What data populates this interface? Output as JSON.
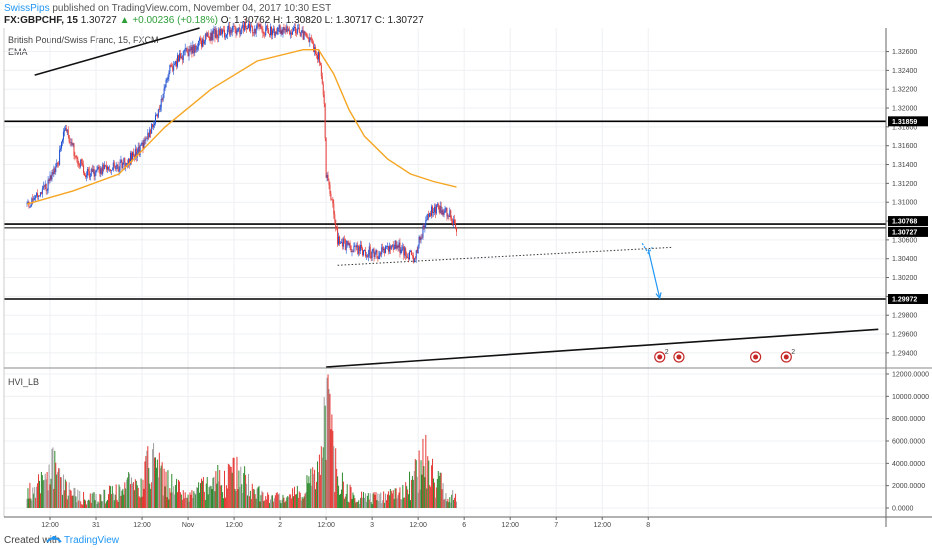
{
  "header": {
    "publisher": "SwissPips",
    "published_text": "published on TradingView.com, November 04, 2017 10:30 EST",
    "symbol": "FX:GBPCHF, 15",
    "last_price": "1.30727",
    "change": "+0.00236 (+0.18%)",
    "ohlc": "O: 1.30762  H: 1.30820  L: 1.30717  C: 1.30727"
  },
  "main_pane": {
    "instrument": "British Pound/Swiss Franc, 15, FXCM",
    "indicator": "EMA"
  },
  "volume_pane": {
    "indicator": "HVI_LB"
  },
  "footer": {
    "created_with": "Created with",
    "brand": "TradingView"
  },
  "colors": {
    "bull": "#2e8b2e",
    "bear": "#e53935",
    "neutral_vol": "#9e9e9e",
    "ema": "#f5a623",
    "level": "#000000",
    "projection": "#2196f3",
    "accent": "#2196f3"
  },
  "chart_data": [
    {
      "type": "candlestick",
      "title": "British Pound/Swiss Franc, 15, FXCM",
      "ylim": [
        1.2925,
        1.3285
      ],
      "x_ticks": [
        "12:00",
        "31",
        "12:00",
        "Nov",
        "12:00",
        "2",
        "12:00",
        "3",
        "12:00",
        "6",
        "12:00",
        "7",
        "12:00",
        "8"
      ],
      "y_ticks": [
        "1.32600",
        "1.32400",
        "1.32200",
        "1.32000",
        "1.31800",
        "1.31600",
        "1.31400",
        "1.31200",
        "1.31000",
        "1.30800",
        "1.30600",
        "1.30400",
        "1.30200",
        "1.30000",
        "1.29800",
        "1.29600",
        "1.29400"
      ],
      "price_tags": [
        "1.31859",
        "1.30768",
        "1.30727",
        "1.29972"
      ],
      "horizontal_levels": [
        1.31859,
        1.30768,
        1.30727,
        1.29972
      ],
      "trendlines": [
        {
          "from": [
            "Oct 30 08:00",
            1.3235
          ],
          "to": [
            "Nov 1 03:00",
            1.3285
          ]
        },
        {
          "from": [
            "Nov 2 12:00",
            1.2925
          ],
          "to": [
            "Nov 8 12:00",
            1.2965
          ]
        }
      ],
      "support_dotted": {
        "from": [
          "Nov 2 15:00",
          1.3033
        ],
        "to": [
          "Nov 6 06:00",
          1.3052
        ]
      },
      "projection_arrow": {
        "from": [
          "Nov 6 00:00",
          1.305
        ],
        "to": [
          "Nov 6 03:00",
          1.2998
        ]
      },
      "price_path": [
        [
          "Oct 30 06:00",
          1.3098
        ],
        [
          "Oct 30 09:00",
          1.3105
        ],
        [
          "Oct 30 11:00",
          1.3115
        ],
        [
          "Oct 30 14:00",
          1.314
        ],
        [
          "Oct 30 16:00",
          1.318
        ],
        [
          "Oct 30 19:00",
          1.3145
        ],
        [
          "Oct 30 22:00",
          1.3128
        ],
        [
          "Oct 31 02:00",
          1.3135
        ],
        [
          "Oct 31 07:00",
          1.314
        ],
        [
          "Oct 31 10:00",
          1.315
        ],
        [
          "Oct 31 13:00",
          1.3165
        ],
        [
          "Oct 31 16:00",
          1.3195
        ],
        [
          "Oct 31 19:00",
          1.324
        ],
        [
          "Oct 31 22:00",
          1.3255
        ],
        [
          "Nov 1 02:00",
          1.3265
        ],
        [
          "Nov 1 05:00",
          1.3275
        ],
        [
          "Nov 1 08:00",
          1.328
        ],
        [
          "Nov 1 11:00",
          1.3282
        ],
        [
          "Nov 1 15:00",
          1.3285
        ],
        [
          "Nov 1 19:00",
          1.3283
        ],
        [
          "Nov 2 00:00",
          1.3282
        ],
        [
          "Nov 2 05:00",
          1.328
        ],
        [
          "Nov 2 08:00",
          1.327
        ],
        [
          "Nov 2 10:00",
          1.3255
        ],
        [
          "Nov 2 11:30",
          1.321
        ],
        [
          "Nov 2 12:00",
          1.313
        ],
        [
          "Nov 2 13:00",
          1.311
        ],
        [
          "Nov 2 14:00",
          1.309
        ],
        [
          "Nov 2 15:00",
          1.306
        ],
        [
          "Nov 2 18:00",
          1.3052
        ],
        [
          "Nov 2 22:00",
          1.3048
        ],
        [
          "Nov 3 02:00",
          1.3045
        ],
        [
          "Nov 3 06:00",
          1.3055
        ],
        [
          "Nov 3 09:00",
          1.3045
        ],
        [
          "Nov 3 11:00",
          1.304
        ],
        [
          "Nov 3 13:00",
          1.3068
        ],
        [
          "Nov 3 15:00",
          1.3088
        ],
        [
          "Nov 3 17:00",
          1.3095
        ],
        [
          "Nov 3 19:00",
          1.309
        ],
        [
          "Nov 3 20:30",
          1.3085
        ],
        [
          "Nov 3 22:00",
          1.3073
        ]
      ],
      "ema_path": [
        [
          "Oct 30 06:00",
          1.3098
        ],
        [
          "Oct 30 18:00",
          1.3112
        ],
        [
          "Oct 31 06:00",
          1.313
        ],
        [
          "Oct 31 18:00",
          1.318
        ],
        [
          "Nov 1 06:00",
          1.322
        ],
        [
          "Nov 1 18:00",
          1.325
        ],
        [
          "Nov 2 06:00",
          1.3262
        ],
        [
          "Nov 2 10:00",
          1.3262
        ],
        [
          "Nov 2 14:00",
          1.3236
        ],
        [
          "Nov 2 18:00",
          1.3198
        ],
        [
          "Nov 2 22:00",
          1.317
        ],
        [
          "Nov 3 04:00",
          1.3146
        ],
        [
          "Nov 3 10:00",
          1.313
        ],
        [
          "Nov 3 16:00",
          1.3122
        ],
        [
          "Nov 3 22:00",
          1.3116
        ]
      ]
    },
    {
      "type": "bar",
      "title": "HVI_LB",
      "ylim": [
        0,
        12000
      ],
      "y_ticks": [
        "12000.0000",
        "10000.0000",
        "8000.0000",
        "6000.0000",
        "4000.0000",
        "2000.0000",
        "0.0000"
      ],
      "volume_profile": [
        [
          "Oct 30 06:00",
          1800
        ],
        [
          "Oct 30 10:00",
          3500
        ],
        [
          "Oct 30 13:00",
          4800
        ],
        [
          "Oct 30 16:00",
          2500
        ],
        [
          "Oct 30 20:00",
          1200
        ],
        [
          "Oct 31 02:00",
          1400
        ],
        [
          "Oct 31 08:00",
          2600
        ],
        [
          "Oct 31 12:00",
          3800
        ],
        [
          "Oct 31 15:00",
          5500
        ],
        [
          "Oct 31 19:00",
          2800
        ],
        [
          "Nov 1 01:00",
          1400
        ],
        [
          "Nov 1 06:00",
          3000
        ],
        [
          "Nov 1 10:00",
          3600
        ],
        [
          "Nov 1 13:00",
          4200
        ],
        [
          "Nov 1 16:00",
          2500
        ],
        [
          "Nov 1 20:00",
          1300
        ],
        [
          "Nov 2 02:00",
          1200
        ],
        [
          "Nov 2 07:00",
          2500
        ],
        [
          "Nov 2 10:00",
          4000
        ],
        [
          "Nov 2 12:00",
          11500
        ],
        [
          "Nov 2 13:30",
          8000
        ],
        [
          "Nov 2 15:00",
          3200
        ],
        [
          "Nov 2 19:00",
          1500
        ],
        [
          "Nov 3 01:00",
          1200
        ],
        [
          "Nov 3 06:00",
          1500
        ],
        [
          "Nov 3 10:00",
          2800
        ],
        [
          "Nov 3 12:00",
          4200
        ],
        [
          "Nov 3 13:00",
          6000
        ],
        [
          "Nov 3 14:30",
          5500
        ],
        [
          "Nov 3 16:00",
          3500
        ],
        [
          "Nov 3 20:00",
          1800
        ],
        [
          "Nov 3 22:00",
          1000
        ]
      ]
    }
  ]
}
